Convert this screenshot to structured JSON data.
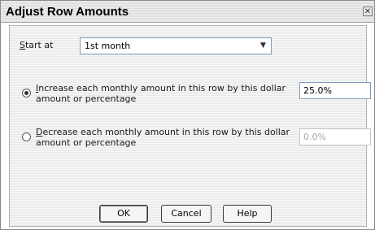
{
  "dialog": {
    "title": "Adjust Row Amounts",
    "close_glyph": "✕"
  },
  "start": {
    "label_accel": "S",
    "label_rest": "tart at",
    "selected": "1st month",
    "arrow_icon": "chevron-down-icon"
  },
  "increase": {
    "accel": "I",
    "line1_rest": "ncrease each monthly amount in this row by this dollar",
    "line2": "amount or percentage",
    "value": "25.0%",
    "selected": true
  },
  "decrease": {
    "accel": "D",
    "line1_rest": "ecrease each monthly amount in this row by this dollar",
    "line2": "amount or percentage",
    "value": "0.0%",
    "selected": false
  },
  "buttons": {
    "ok": "OK",
    "cancel": "Cancel",
    "help": "Help"
  }
}
